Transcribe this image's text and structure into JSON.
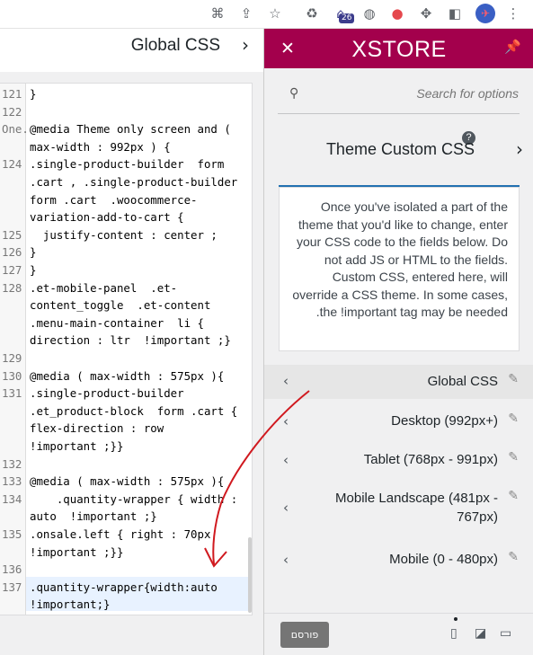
{
  "browser": {
    "icons": [
      "translate-icon",
      "share-icon",
      "star-icon",
      "recycle-icon",
      "graduation-cap-extension-icon",
      "globe-icon",
      "color-wheel-icon",
      "puzzle-icon",
      "sidebar-icon",
      "profile-avatar",
      "more-vert-icon"
    ],
    "extension_badge": "26"
  },
  "editor": {
    "header_title": "Global CSS",
    "lines": [
      {
        "no": "121",
        "text": "}"
      },
      {
        "no": "122",
        "text": ""
      },
      {
        "no": "One.",
        "text": "@media Theme only screen and ("
      },
      {
        "no": "",
        "text": "max-width : 992px ) {"
      },
      {
        "no": "124",
        "text": ".single-product-builder  form"
      },
      {
        "no": "",
        "text": ".cart , .single-product-builder"
      },
      {
        "no": "",
        "text": "form .cart  .woocommerce-"
      },
      {
        "no": "",
        "text": "variation-add-to-cart {"
      },
      {
        "no": "125",
        "text": "  justify-content : center ;"
      },
      {
        "no": "126",
        "text": "}"
      },
      {
        "no": "127",
        "text": "}"
      },
      {
        "no": "128",
        "text": ".et-mobile-panel  .et-"
      },
      {
        "no": "",
        "text": "content_toggle  .et-content"
      },
      {
        "no": "",
        "text": ".menu-main-container  li {"
      },
      {
        "no": "",
        "text": "direction : ltr  !important ;}"
      },
      {
        "no": "129",
        "text": ""
      },
      {
        "no": "130",
        "text": "@media ( max-width : 575px ){"
      },
      {
        "no": "131",
        "text": ".single-product-builder"
      },
      {
        "no": "",
        "text": ".et_product-block  form .cart {"
      },
      {
        "no": "",
        "text": "flex-direction : row"
      },
      {
        "no": "",
        "text": "!important ;}}"
      },
      {
        "no": "132",
        "text": ""
      },
      {
        "no": "133",
        "text": "@media ( max-width : 575px ){"
      },
      {
        "no": "134",
        "text": "    .quantity-wrapper { width :"
      },
      {
        "no": "",
        "text": "auto  !important ;}"
      },
      {
        "no": "135",
        "text": ".onsale.left { right : 70px"
      },
      {
        "no": "",
        "text": "!important ;}}"
      },
      {
        "no": "136",
        "text": ""
      },
      {
        "no": "137",
        "text": ".quantity-wrapper{width:auto"
      },
      {
        "no": "",
        "text": "!important;}"
      }
    ]
  },
  "panel": {
    "brand": "XSTORE",
    "search_placeholder": "Search for options",
    "section_title": "Theme Custom CSS",
    "help": "?",
    "description": "Once you've isolated a part of the theme that you'd like to change, enter your CSS code to the fields below. Do not add JS or HTML to the fields. Custom CSS, entered here, will override a CSS theme. In some cases, the !important tag may be needed.",
    "rows": [
      {
        "label": "Global CSS"
      },
      {
        "label": "Desktop (992px+)"
      },
      {
        "label": "Tablet (768px - 991px)"
      },
      {
        "label": "Mobile Landscape (481px - 767px)"
      },
      {
        "label": "Mobile (0 - 480px)"
      }
    ],
    "publish_label": "פורסם",
    "chevron_right": "›",
    "chevron_left": "‹",
    "close_glyph": "✕",
    "pin_glyph": "📌",
    "edit_glyph": "✎"
  },
  "colors": {
    "brand": "#a3004c",
    "active_line": "#e8f2ff",
    "annotation": "#d0191f"
  }
}
